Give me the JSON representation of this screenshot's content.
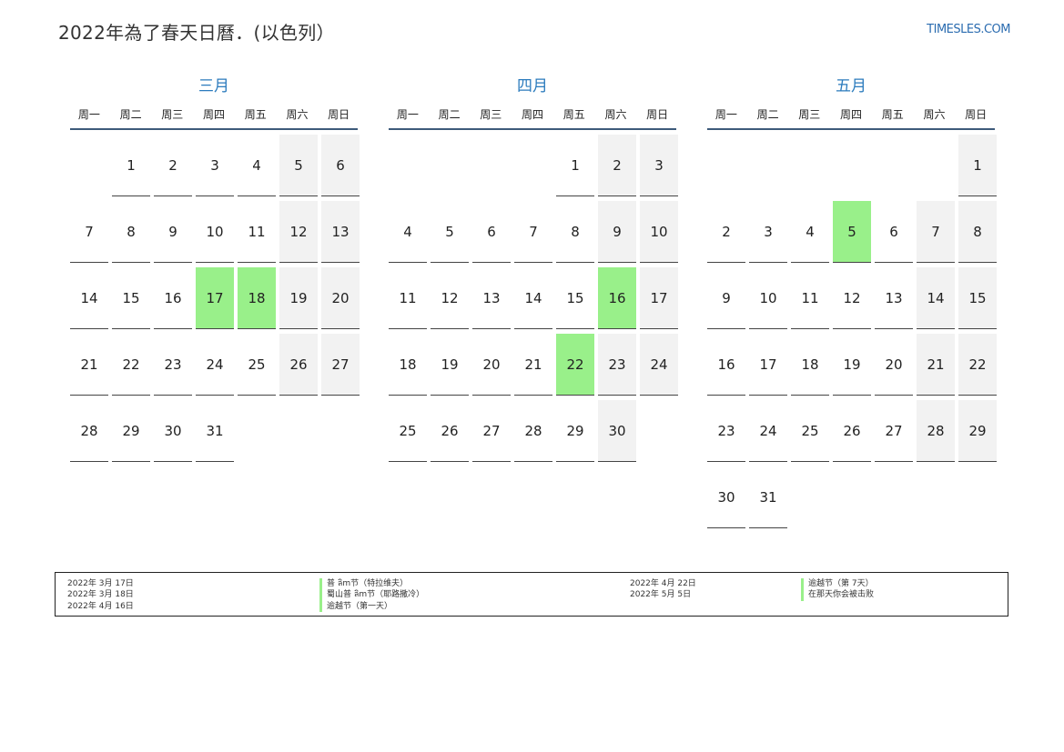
{
  "page": {
    "title": "2022年為了春天日曆．(以色列）",
    "site": "TIMESLES.COM"
  },
  "weekdays": [
    "周一",
    "周二",
    "周三",
    "周四",
    "周五",
    "周六",
    "周日"
  ],
  "months": [
    {
      "name": "三月",
      "offset": 1,
      "days": 31,
      "holidays": [
        17,
        18
      ]
    },
    {
      "name": "四月",
      "offset": 4,
      "days": 30,
      "holidays": [
        16,
        22
      ]
    },
    {
      "name": "五月",
      "offset": 6,
      "days": 31,
      "holidays": [
        5
      ]
    }
  ],
  "legend": {
    "col1_dates": [
      "2022年 3月 17日",
      "2022年 3月 18日",
      "2022年 4月 16日"
    ],
    "col1_names": [
      "普 ลิm节（特拉维夫）",
      "蜀山普 ลิm节（耶路撒冷）",
      "逾越节（第一天）"
    ],
    "col2_dates": [
      "2022年 4月 22日",
      "2022年 5月 5日"
    ],
    "col2_names": [
      "逾越节（第 7天）",
      "在那天你会被击败"
    ]
  }
}
